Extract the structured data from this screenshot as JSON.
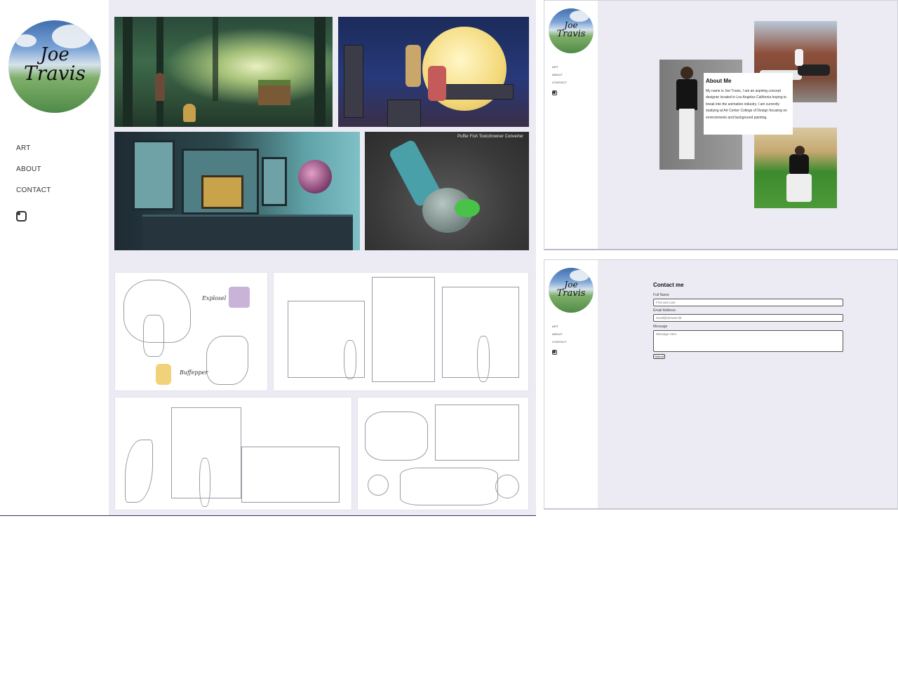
{
  "site": {
    "logo_text_line1": "Joe",
    "logo_text_line2": "Travis",
    "nav": {
      "art": "ART",
      "about": "ABOUT",
      "contact": "CONTACT"
    },
    "instagram_icon": "instagram-icon"
  },
  "art_page": {
    "fish_caption": "Puffer Fish Toxicdrowner Converter",
    "sketch_tag_1": "Explosel",
    "sketch_tag_2": "Buffepper"
  },
  "about_page": {
    "card_title": "About Me",
    "card_text": "My name is Joe Travis, I am an aspiring concept designer located in Los Angeles California hoping to break into the animation industry. I am currently studying at Art Center College of Design focusing on environments and background painting."
  },
  "contact_page": {
    "title": "Contact me",
    "full_name_label": "Full Name",
    "full_name_placeholder": "First and Last",
    "email_label": "Email Address",
    "email_placeholder": "email@domain.tld",
    "message_label": "Message",
    "message_placeholder": "Message Here",
    "submit_label": "Submit"
  },
  "colors": {
    "content_bg": "#ecebf4",
    "sidebar_bg": "#ffffff",
    "text": "#333333"
  }
}
